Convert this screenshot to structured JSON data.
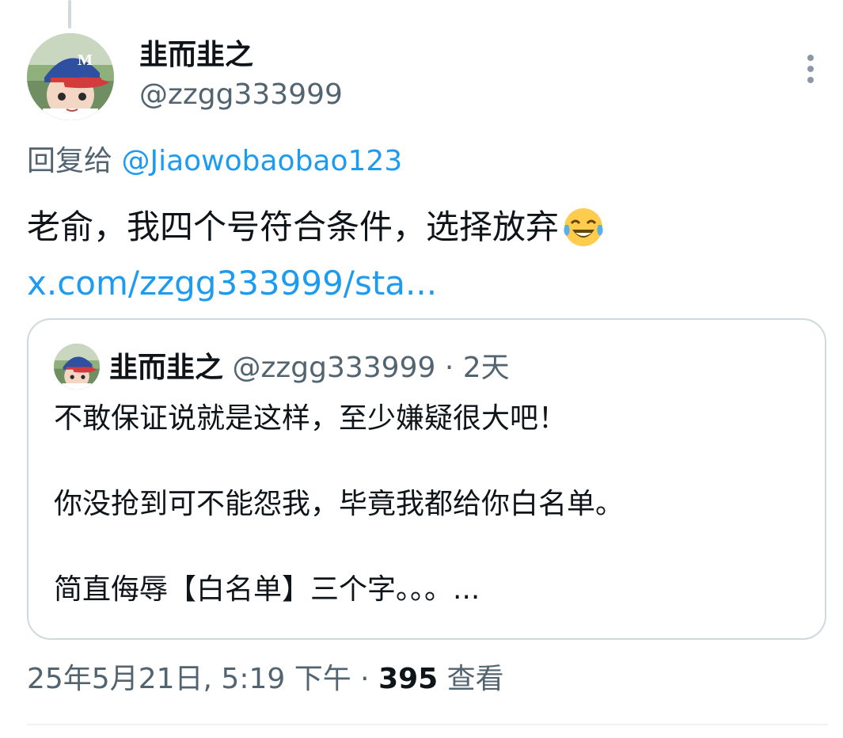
{
  "tweet": {
    "display_name": "韭而韭之",
    "handle": "@zzgg333999",
    "reply_prefix": "回复给",
    "reply_to": "@Jiaowobaobao123",
    "text": "老俞，我四个号符合条件，选择放弃",
    "emoji": "face-with-tears-of-joy",
    "link": "x.com/zzgg333999/sta...",
    "timestamp": "25年5月21日, 5:19 下午",
    "separator": "·",
    "views_count": "395",
    "views_label": "查看"
  },
  "quote": {
    "display_name": "韭而韭之",
    "handle": "@zzgg333999",
    "separator": "·",
    "time": "2天",
    "lines": [
      "不敢保证说就是这样，至少嫌疑很大吧！",
      "你没抢到可不能怨我，毕竟我都给你白名单。",
      "简直侮辱【白名单】三个字。。。..."
    ]
  },
  "colors": {
    "text_primary": "#0f1419",
    "text_secondary": "#536471",
    "link": "#1d9bf0",
    "border": "#cfd9de"
  }
}
